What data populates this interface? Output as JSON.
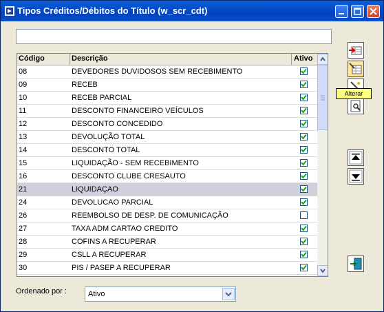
{
  "window": {
    "title": "Tipos Créditos/Débitos do Título (w_scr_cdt)"
  },
  "search": {
    "value": ""
  },
  "grid": {
    "headers": {
      "code": "Código",
      "description": "Descrição",
      "active": "Ativo"
    },
    "rows": [
      {
        "code": "08",
        "description": "DEVEDORES DUVIDOSOS SEM RECEBIMENTO",
        "active": true
      },
      {
        "code": "09",
        "description": "RECEB",
        "active": true
      },
      {
        "code": "10",
        "description": "RECEB PARCIAL",
        "active": true
      },
      {
        "code": "11",
        "description": "DESCONTO FINANCEIRO VEÍCULOS",
        "active": true
      },
      {
        "code": "12",
        "description": "DESCONTO CONCEDIDO",
        "active": true
      },
      {
        "code": "13",
        "description": "DEVOLUÇÃO TOTAL",
        "active": true
      },
      {
        "code": "14",
        "description": "DESCONTO TOTAL",
        "active": true
      },
      {
        "code": "15",
        "description": "LIQUIDAÇÃO - SEM RECEBIMENTO",
        "active": true
      },
      {
        "code": "16",
        "description": "DESCONTO CLUBE CRESAUTO",
        "active": true
      },
      {
        "code": "21",
        "description": "LIQUIDAÇAO",
        "active": true,
        "selected": true
      },
      {
        "code": "24",
        "description": "DEVOLUCAO PARCIAL",
        "active": true
      },
      {
        "code": "26",
        "description": "REEMBOLSO DE DESP. DE COMUNICAÇÃO",
        "active": false
      },
      {
        "code": "27",
        "description": "TAXA ADM CARTAO CREDITO",
        "active": true
      },
      {
        "code": "28",
        "description": "COFINS A RECUPERAR",
        "active": true
      },
      {
        "code": "29",
        "description": "CSLL A RECUPERAR",
        "active": true
      },
      {
        "code": "30",
        "description": "PIS / PASEP A RECUPERAR",
        "active": true
      }
    ]
  },
  "tooltip": {
    "text": "Alterar"
  },
  "order": {
    "label": "Ordenado por :",
    "value": "Ativo"
  },
  "colors": {
    "titlebar": "#0342c0",
    "selected_row": "#cfd0dc",
    "check": "#1ea51e",
    "tooltip": "#ffff80"
  },
  "icons": {
    "toolbar": [
      "insert-row-icon",
      "edit-grid-icon",
      "delete-wand-icon",
      "search-preview-icon"
    ],
    "nav": [
      "move-up-icon",
      "move-down-icon"
    ],
    "exit": "exit-door-icon"
  }
}
